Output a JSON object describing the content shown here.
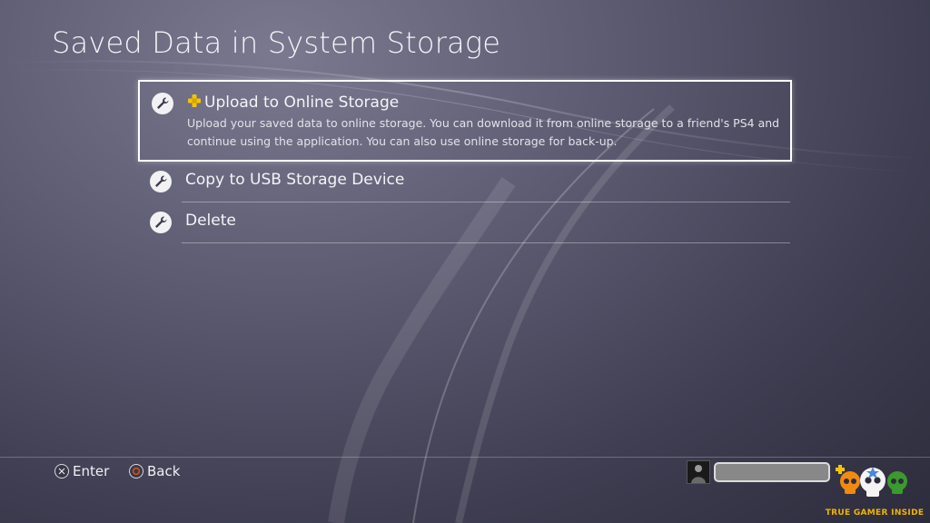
{
  "page": {
    "title": "Saved Data in System Storage"
  },
  "menu": {
    "items": [
      {
        "icon": "wrench-icon",
        "label": "Upload to Online Storage",
        "badge": "ps-plus-icon",
        "description": "Upload your saved data to online storage. You can download it from online storage to a friend's PS4 and continue using the application. You can also use online storage for back-up."
      },
      {
        "icon": "wrench-icon",
        "label": "Copy to USB Storage Device"
      },
      {
        "icon": "wrench-icon",
        "label": "Delete"
      }
    ]
  },
  "footer": {
    "enter_label": "Enter",
    "back_label": "Back",
    "enter_icon": "cross-button-icon",
    "back_icon": "circle-button-icon"
  },
  "user": {
    "avatar": "user-avatar",
    "name_field_value": ""
  },
  "watermark": {
    "text": "TRUE GAMER INSIDE"
  },
  "colors": {
    "accent": "#ffffff",
    "ps_plus": "#f5c400",
    "circle_button": "#e0501a"
  }
}
